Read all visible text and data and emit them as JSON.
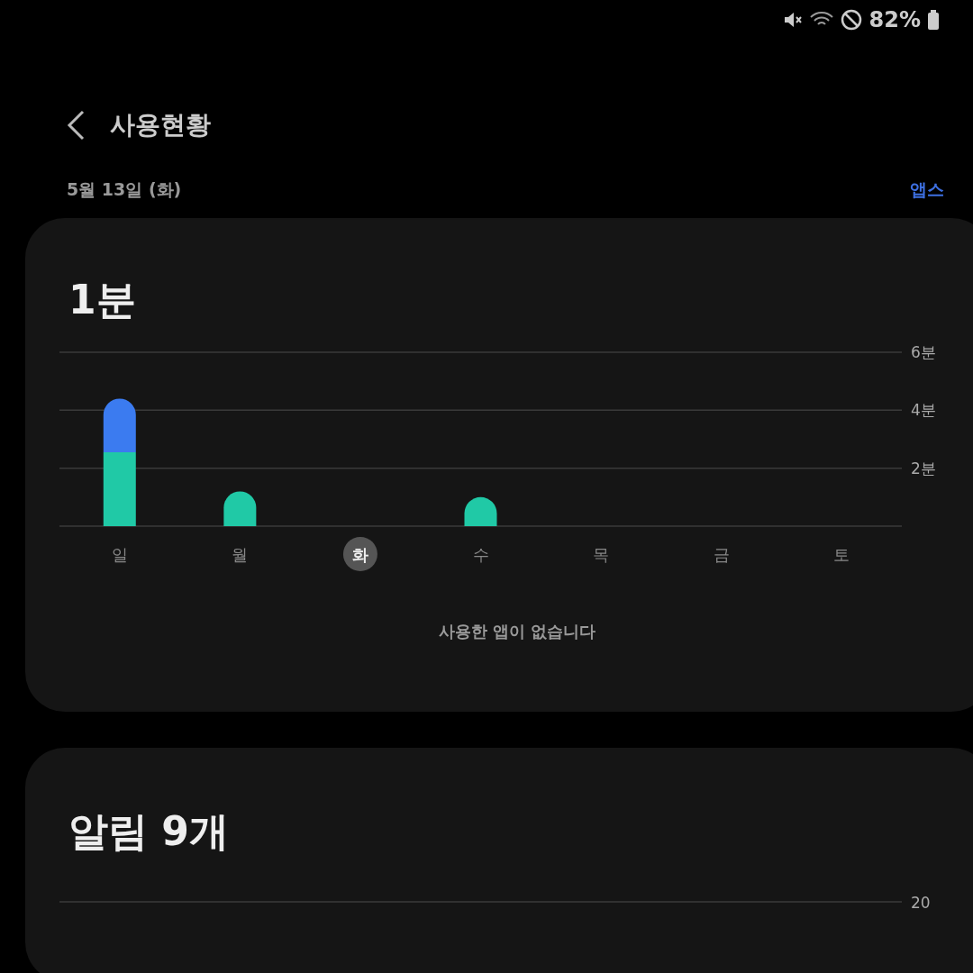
{
  "status_bar": {
    "battery_text": "82%"
  },
  "header": {
    "title": "사용현황"
  },
  "date_row": {
    "date": "5월 13일 (화)",
    "link": "앱스"
  },
  "usage_card": {
    "total": "1분",
    "chart_data": {
      "type": "bar",
      "stacked": true,
      "categories": [
        "일",
        "월",
        "화",
        "수",
        "목",
        "금",
        "토"
      ],
      "series": [
        {
          "color": "#20c9a6",
          "values": [
            2.55,
            1.2,
            0,
            1.0,
            0,
            0,
            0
          ]
        },
        {
          "color": "#3b7bf0",
          "values": [
            1.85,
            0,
            0,
            0,
            0,
            0,
            0
          ]
        }
      ],
      "ylim": [
        0,
        6
      ],
      "yticks": [
        {
          "value": 2,
          "label": "2분"
        },
        {
          "value": 4,
          "label": "4분"
        },
        {
          "value": 6,
          "label": "6분"
        }
      ]
    },
    "days": [
      {
        "selected": false
      },
      {
        "selected": false
      },
      {
        "selected": true
      },
      {
        "selected": false
      },
      {
        "selected": false
      },
      {
        "selected": false
      },
      {
        "selected": false
      }
    ],
    "empty_message": "사용한 앱이 없습니다"
  },
  "notifications_card": {
    "title": "알림 9개",
    "axis_label": "20"
  }
}
